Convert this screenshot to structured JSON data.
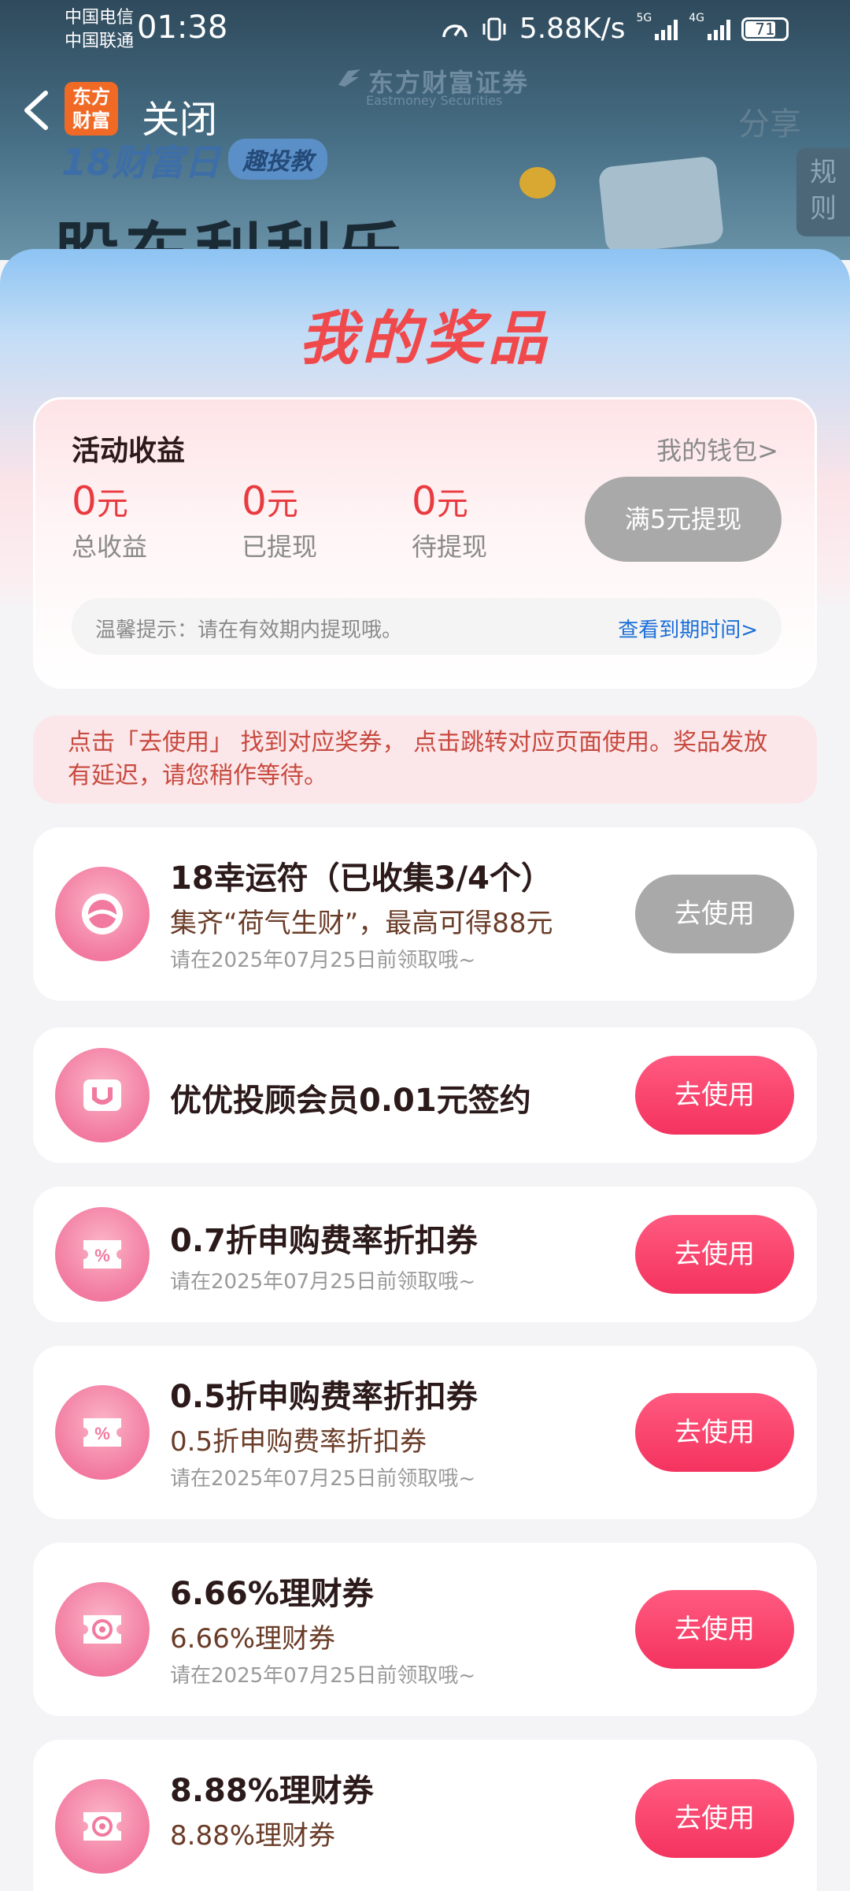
{
  "status_bar": {
    "carrier_1": "中国电信",
    "carrier_2": "中国联通",
    "time": "01:38",
    "speed": "5.88K/s",
    "net_1": "5G",
    "net_2": "4G",
    "battery": "71"
  },
  "nav": {
    "app_logo": "东方财富",
    "close_label": "关闭"
  },
  "background": {
    "brand": "东方财富证券",
    "brand_en": "Eastmoney Securities",
    "campaign": "18财富日",
    "campaign_tag": "趣投教",
    "headline": "股东利利乐",
    "share_label": "分享",
    "rules_label": "规则"
  },
  "panel": {
    "title": "我的奖品"
  },
  "earnings": {
    "title": "活动收益",
    "wallet_link": "我的钱包>",
    "unit": "元",
    "stats": [
      {
        "value": "0",
        "label": "总收益"
      },
      {
        "value": "0",
        "label": "已提现"
      },
      {
        "value": "0",
        "label": "待提现"
      }
    ],
    "withdraw_button": "满5元提现",
    "tip": "温馨提示：请在有效期内提现哦。",
    "tip_link": "查看到期时间>"
  },
  "notice": "点击「去使用」 找到对应奖券， 点击跳转对应页面使用。奖品发放有延迟，请您稍作等待。",
  "prizes": [
    {
      "title": "18幸运符（已收集3/4个）",
      "subtitle": "集齐“荷气生财”，最高可得88元",
      "expiry": "请在2025年07月25日前领取哦~",
      "button": "去使用",
      "icon": "eastmoney-badge-icon"
    },
    {
      "title": "优优投顾会员0.01元签约",
      "subtitle": "",
      "expiry": "",
      "button": "去使用",
      "icon": "vip-ticket-icon"
    },
    {
      "title": "0.7折申购费率折扣券",
      "subtitle": "",
      "expiry": "请在2025年07月25日前领取哦~",
      "button": "去使用",
      "icon": "percent-coupon-icon"
    },
    {
      "title": "0.5折申购费率折扣券",
      "subtitle": "0.5折申购费率折扣券",
      "expiry": "请在2025年07月25日前领取哦~",
      "button": "去使用",
      "icon": "percent-coupon-icon"
    },
    {
      "title": "6.66%理财券",
      "subtitle": "6.66%理财券",
      "expiry": "请在2025年07月25日前领取哦~",
      "button": "去使用",
      "icon": "target-coupon-icon"
    },
    {
      "title": "8.88%理财券",
      "subtitle": "8.88%理财券",
      "expiry": "",
      "button": "去使用",
      "icon": "target-coupon-icon"
    }
  ],
  "colors": {
    "accent_red": "#e93a3f",
    "button_pink": "#f4335f",
    "button_disabled": "#a9a9a9",
    "link_blue": "#1c6fd8"
  }
}
